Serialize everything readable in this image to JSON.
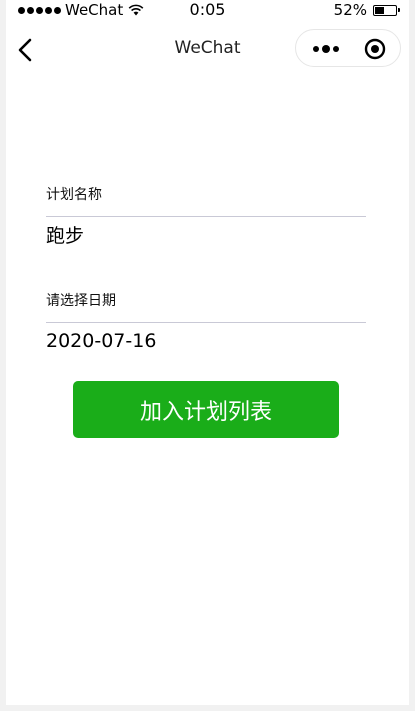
{
  "status_bar": {
    "carrier": "WeChat",
    "time": "0:05",
    "battery_percent_text": "52%",
    "battery_level": 0.52
  },
  "navbar": {
    "title": "WeChat",
    "back_icon": "chevron-left-icon",
    "more_icon": "more-dots-icon",
    "close_icon": "record-circle-icon"
  },
  "form": {
    "plan_name_label": "计划名称",
    "plan_name_value": "跑步",
    "date_label": "请选择日期",
    "date_value": "2020-07-16",
    "submit_label": "加入计划列表"
  },
  "colors": {
    "primary_button": "#1aad19",
    "divider": "#c9c9d6"
  }
}
